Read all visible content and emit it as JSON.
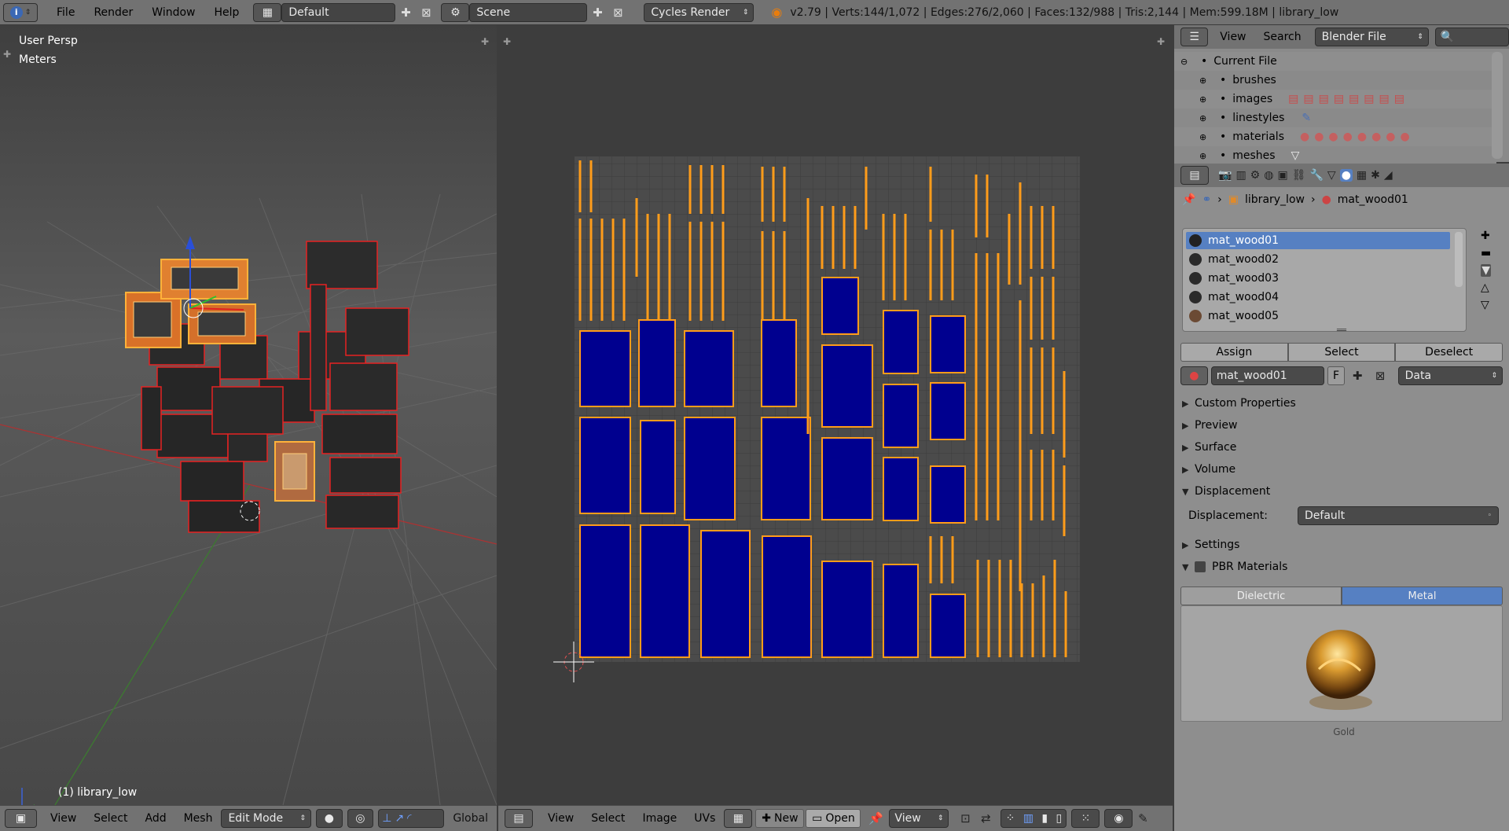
{
  "topbar": {
    "info_icon": "info-icon",
    "menus": [
      "File",
      "Render",
      "Window",
      "Help"
    ],
    "layout_name": "Default",
    "scene_name": "Scene",
    "render_engine": "Cycles Render",
    "stats": "v2.79 | Verts:144/1,072 | Edges:276/2,060 | Faces:132/988 | Tris:2,144 | Mem:599.18M | library_low"
  },
  "viewport": {
    "view_name": "User Persp",
    "units": "Meters",
    "object_label": "(1) library_low",
    "menus": [
      "View",
      "Select",
      "Add",
      "Mesh"
    ],
    "mode": "Edit Mode",
    "orientation": "Global"
  },
  "uv_editor": {
    "menus": [
      "View",
      "Select",
      "Image",
      "UVs"
    ],
    "new_label": "New",
    "open_label": "Open",
    "view_label": "View"
  },
  "outliner": {
    "menus": [
      "View",
      "Search"
    ],
    "display_mode": "Blender File",
    "root": "Current File",
    "items": [
      "brushes",
      "images",
      "linestyles",
      "materials",
      "meshes"
    ]
  },
  "properties": {
    "breadcrumb_object": "library_low",
    "breadcrumb_material": "mat_wood01",
    "materials": [
      "mat_wood01",
      "mat_wood02",
      "mat_wood03",
      "mat_wood04",
      "mat_wood05"
    ],
    "selected_material": "mat_wood01",
    "assign_label": "Assign",
    "select_label": "Select",
    "deselect_label": "Deselect",
    "material_name": "mat_wood01",
    "fake_user": "F",
    "link_mode": "Data",
    "panels": [
      "Custom Properties",
      "Preview",
      "Surface",
      "Volume",
      "Displacement"
    ],
    "displacement_label": "Displacement:",
    "displacement_value": "Default",
    "settings_label": "Settings",
    "pbr_label": "PBR Materials",
    "tab_dielectric": "Dielectric",
    "tab_metal": "Metal",
    "preview_caption": "Gold"
  },
  "colors": {
    "accent_blue": "#5680c2",
    "uv_fill": "#00008f",
    "uv_edge": "#ff9c1a"
  }
}
